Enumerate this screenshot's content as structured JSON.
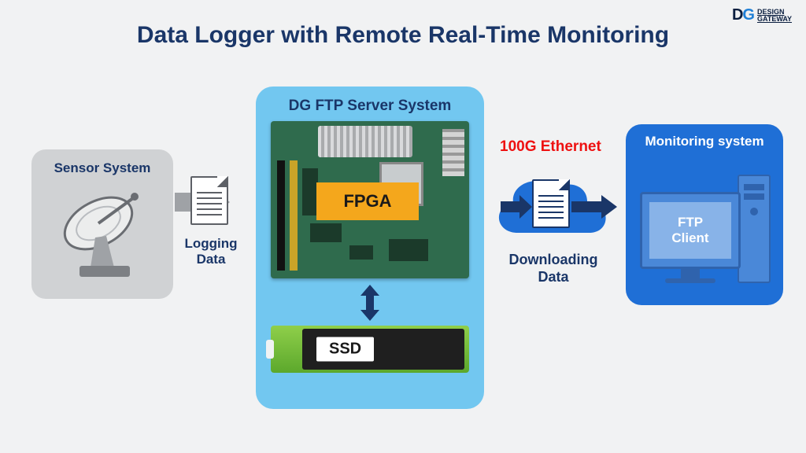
{
  "title": "Data Logger with Remote Real-Time Monitoring",
  "brand": {
    "abbr_d": "D",
    "abbr_g": "G",
    "line1": "DESIGN",
    "line2": "GATEWAY"
  },
  "sensor": {
    "title": "Sensor System"
  },
  "logging": {
    "label": "Logging\nData"
  },
  "server": {
    "title": "DG FTP Server System",
    "fpga_label": "FPGA",
    "ssd_label": "SSD"
  },
  "link": {
    "ethernet_label": "100G Ethernet",
    "downloading_label": "Downloading\nData"
  },
  "monitor": {
    "title": "Monitoring system",
    "client_label": "FTP\nClient"
  },
  "colors": {
    "navy": "#1a3668",
    "sky": "#72c7f0",
    "blue": "#1f6fd6",
    "orange": "#f4a71c",
    "red": "#ee1111",
    "grey": "#d0d2d4"
  }
}
